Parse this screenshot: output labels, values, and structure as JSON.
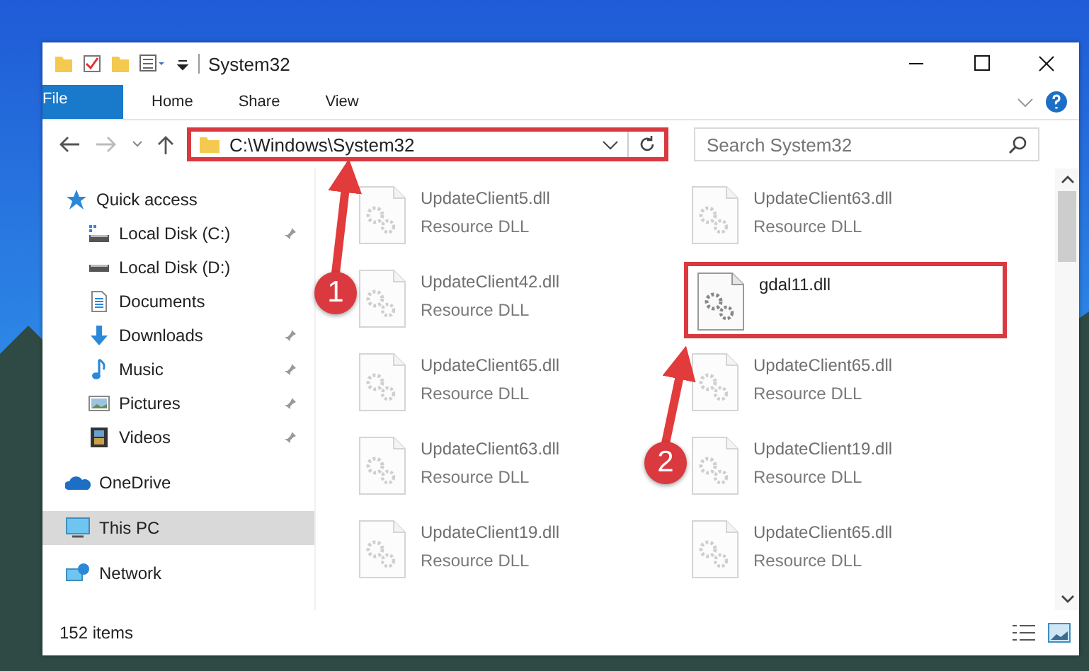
{
  "window": {
    "title": "System32"
  },
  "ribbon_tabs": [
    {
      "label": "File",
      "kind": "file"
    },
    {
      "label": "Home",
      "kind": "tab"
    },
    {
      "label": "Share",
      "kind": "tab"
    },
    {
      "label": "View",
      "kind": "tab"
    }
  ],
  "address": {
    "path": "C:\\Windows\\System32",
    "highlighted": true
  },
  "search": {
    "placeholder": "Search System32"
  },
  "sidebar": {
    "items": [
      {
        "label": "Quick access",
        "selected": false,
        "children": [
          {
            "label": "Local Disk (C:)",
            "pinned": true,
            "selected": false
          },
          {
            "label": "Local Disk (D:)",
            "pinned": false,
            "selected": false
          },
          {
            "label": "Documents",
            "pinned": false,
            "selected": false
          },
          {
            "label": "Downloads",
            "pinned": true,
            "selected": false
          },
          {
            "label": "Music",
            "pinned": true,
            "selected": false
          },
          {
            "label": "Pictures",
            "pinned": true,
            "selected": false
          },
          {
            "label": "Videos",
            "pinned": true,
            "selected": false
          }
        ]
      },
      {
        "label": "OneDrive",
        "selected": false
      },
      {
        "label": "This PC",
        "selected": true
      },
      {
        "label": "Network",
        "selected": false
      }
    ]
  },
  "files": [
    {
      "name": "UpdateClient5.dll",
      "type": "Resource DLL",
      "faded": true,
      "highlighted": false
    },
    {
      "name": "UpdateClient63.dll",
      "type": "Resource DLL",
      "faded": true,
      "highlighted": false
    },
    {
      "name": "UpdateClient42.dll",
      "type": "Resource DLL",
      "faded": true,
      "highlighted": false
    },
    {
      "name": "gdal11.dll",
      "faded": false,
      "highlighted": true
    },
    {
      "name": "UpdateClient65.dll",
      "type": "Resource DLL",
      "faded": true,
      "highlighted": false
    },
    {
      "name": "UpdateClient65.dll",
      "type": "Resource DLL",
      "faded": true,
      "highlighted": false
    },
    {
      "name": "UpdateClient63.dll",
      "type": "Resource DLL",
      "faded": true,
      "highlighted": false
    },
    {
      "name": "UpdateClient19.dll",
      "type": "Resource DLL",
      "faded": true,
      "highlighted": false
    },
    {
      "name": "UpdateClient19.dll",
      "type": "Resource DLL",
      "faded": true,
      "highlighted": false
    },
    {
      "name": "UpdateClient65.dll",
      "type": "Resource DLL",
      "faded": true,
      "highlighted": false
    }
  ],
  "status_bar": {
    "count": "152 items"
  },
  "annotations": [
    {
      "label": "1"
    },
    {
      "label": "2"
    }
  ]
}
